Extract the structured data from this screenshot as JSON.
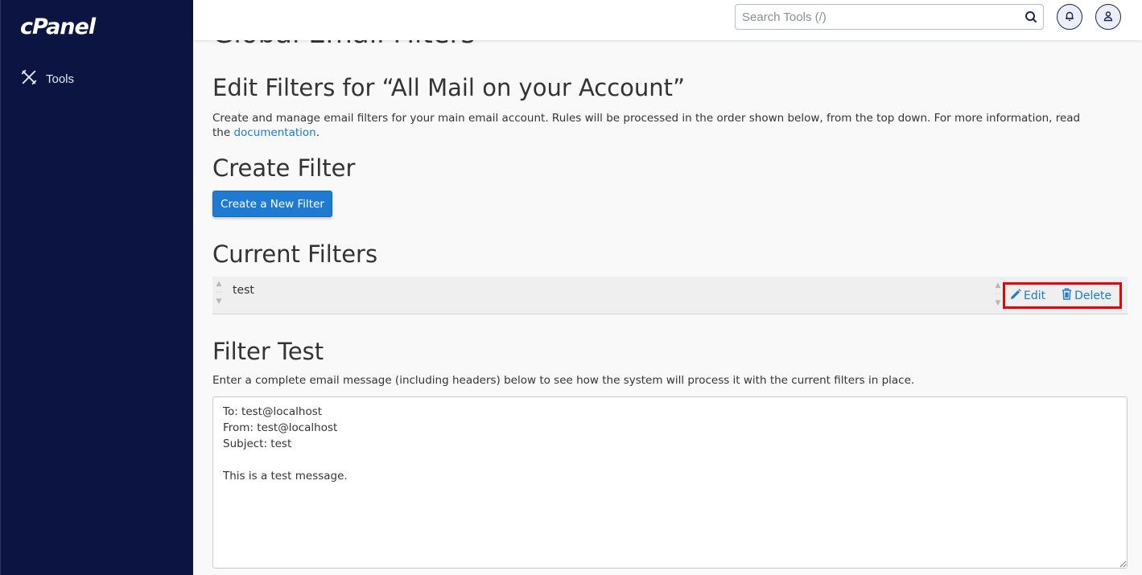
{
  "sidebar": {
    "logo": "cPanel",
    "items": [
      {
        "label": "Tools",
        "icon": "tools-icon"
      }
    ]
  },
  "topbar": {
    "search_placeholder": "Search Tools (/)",
    "search_value": "",
    "notifications_icon": "bell-icon",
    "user_icon": "user-icon"
  },
  "main": {
    "page_title": "Global Email Filters",
    "edit_heading": "Edit Filters for “All Mail on your Account”",
    "description": "Create and manage email filters for your main email account. Rules will be processed in the order shown below, from the top down. For more information, read the ",
    "description_link": "documentation",
    "description_end": ".",
    "create_heading": "Create Filter",
    "create_button": "Create a New Filter",
    "current_heading": "Current Filters",
    "filters": [
      {
        "name": "test",
        "edit_label": "Edit",
        "delete_label": "Delete"
      }
    ],
    "test_heading": "Filter Test",
    "test_description": "Enter a complete email message (including headers) below to see how the system will process it with the current filters in place.",
    "test_message": "To: test@localhost\nFrom: test@localhost\nSubject: test\n\nThis is a test message."
  },
  "colors": {
    "sidebar_bg": "#0c1541",
    "primary": "#1f7bd1",
    "link": "#1f7ac6",
    "highlight": "#e8000b"
  }
}
